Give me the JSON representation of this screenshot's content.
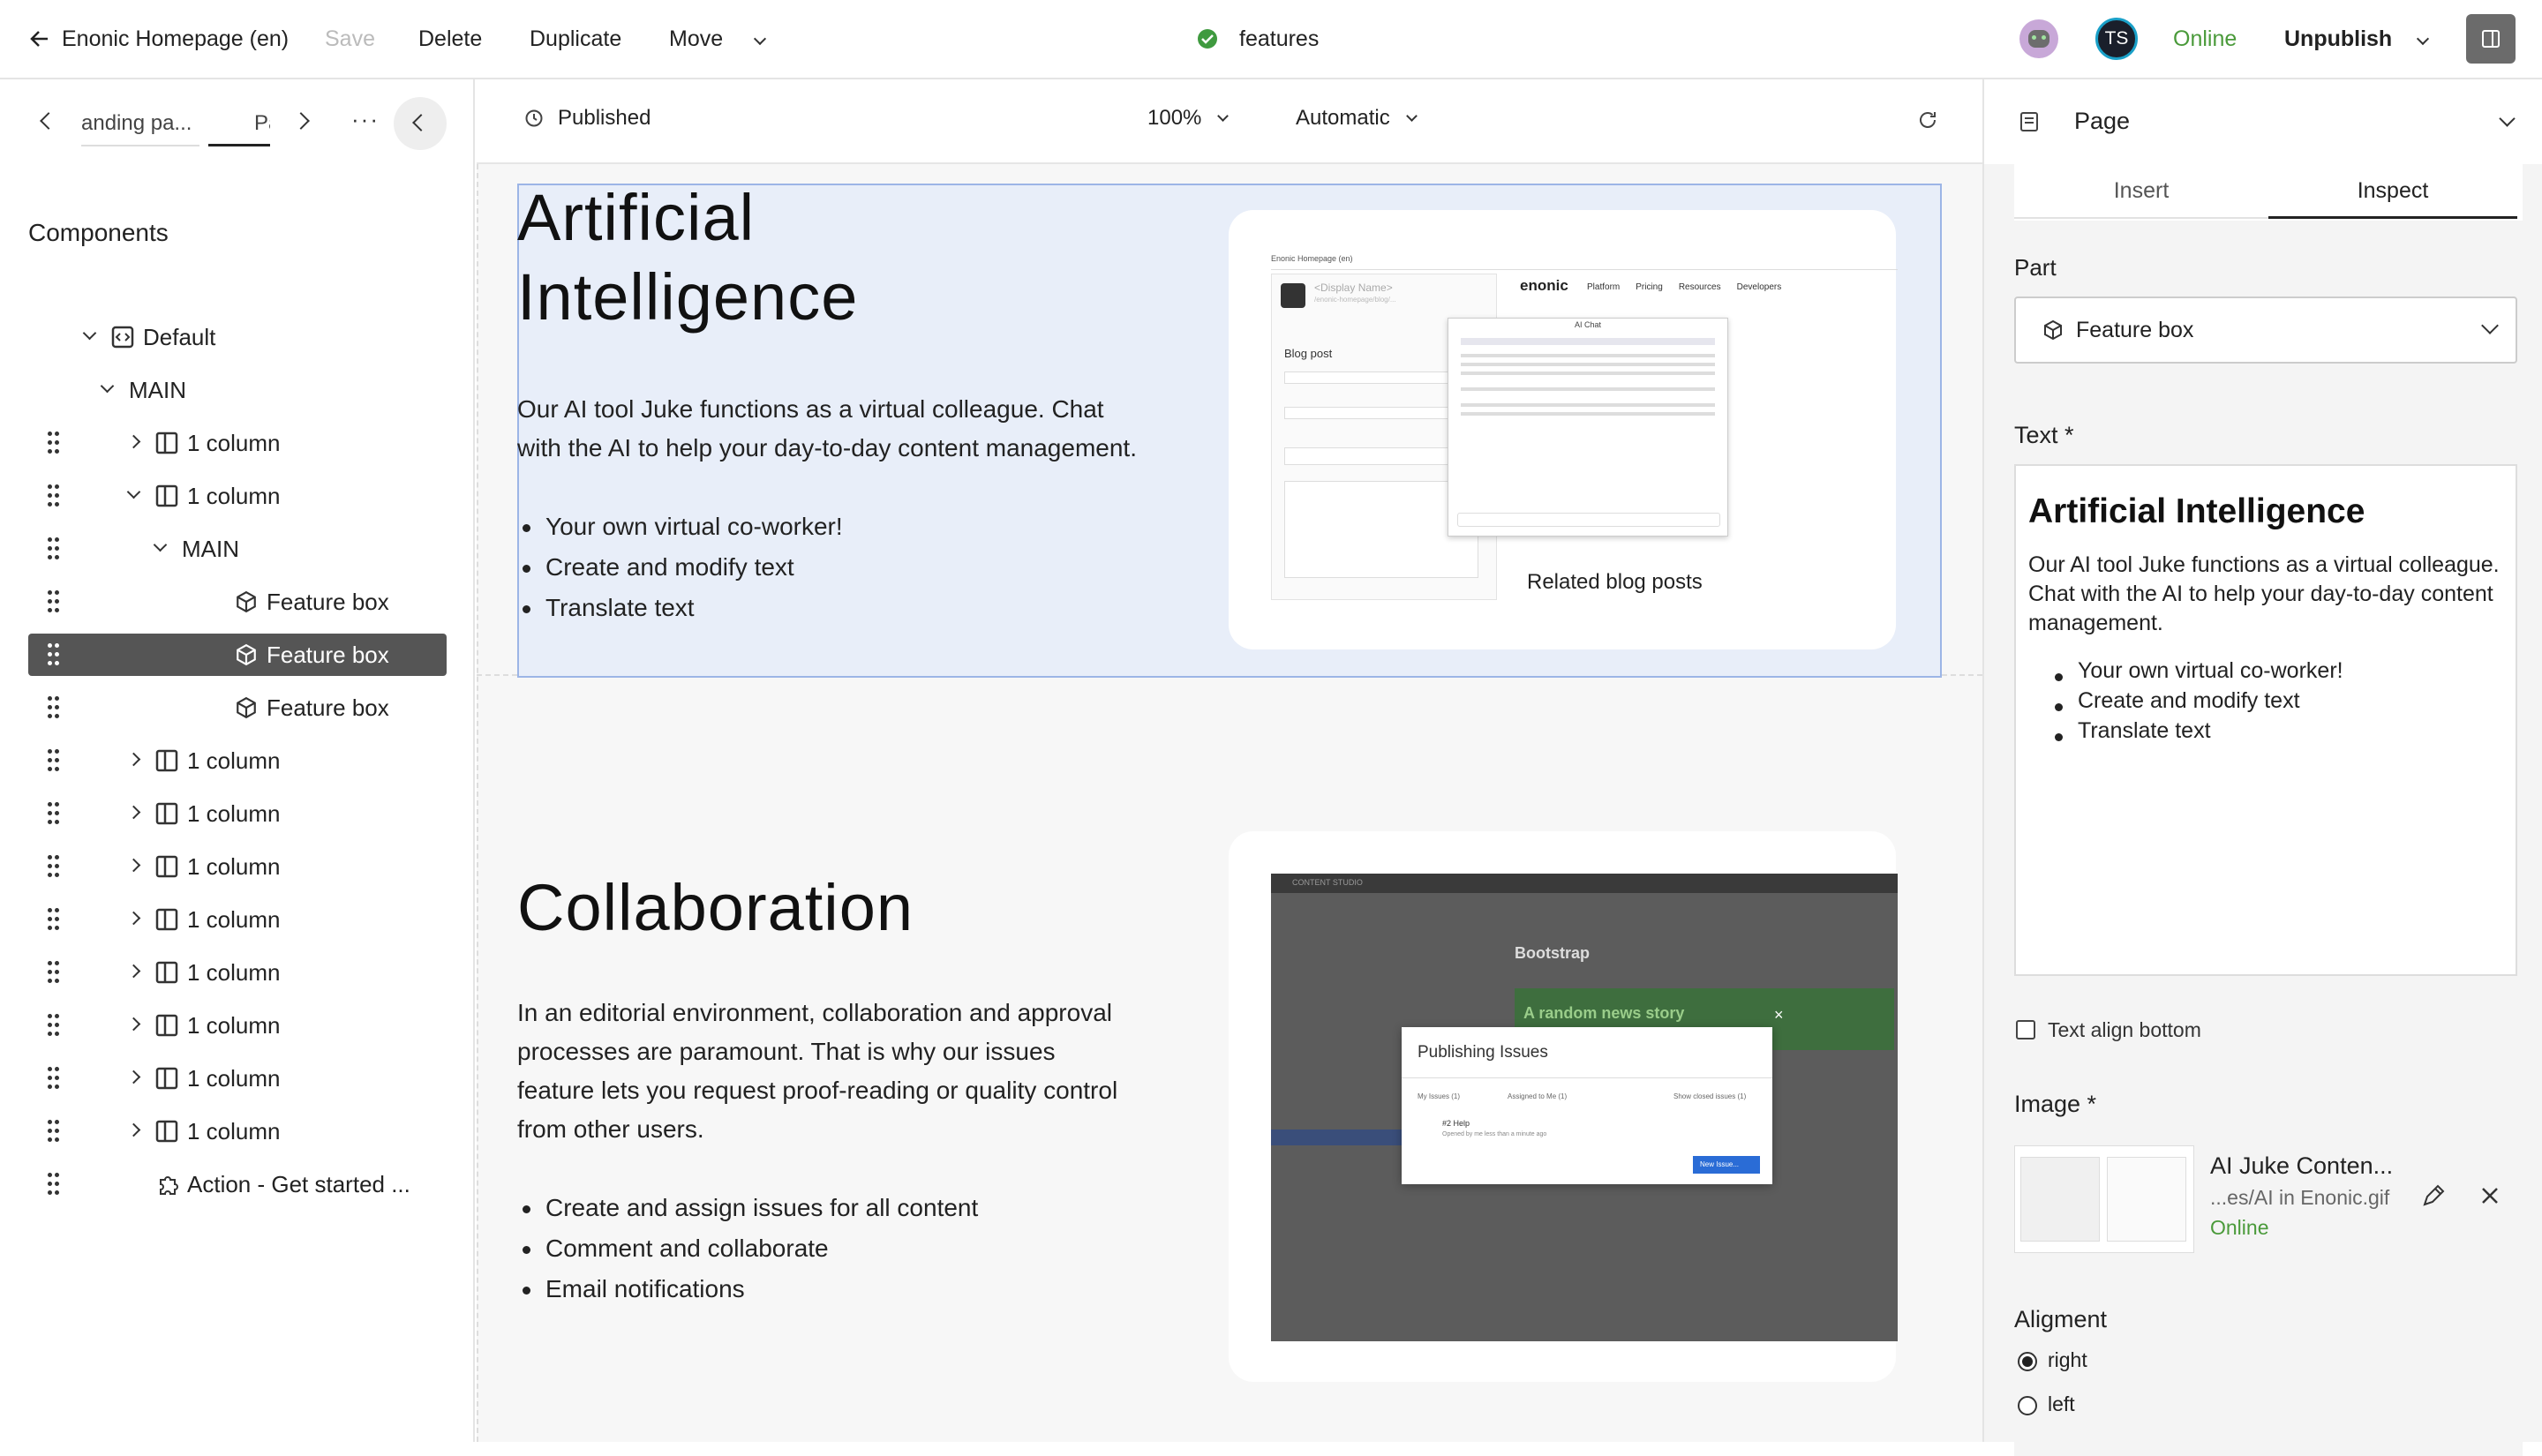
{
  "topbar": {
    "back_label": "Enonic Homepage (en)",
    "save_label": "Save",
    "delete_label": "Delete",
    "duplicate_label": "Duplicate",
    "move_label": "Move",
    "content_name": "features",
    "avatar_initials": "TS",
    "status": "Online",
    "unpublish_label": "Unpublish"
  },
  "left": {
    "tab1": "anding pa...",
    "tab2": "Pa",
    "components_title": "Components",
    "tree": [
      {
        "label": "Default",
        "icon": "template-icon",
        "indent": 0,
        "expanded": true
      },
      {
        "label": "MAIN",
        "icon": "",
        "indent": 1,
        "expanded": true
      },
      {
        "label": "1 column",
        "icon": "layout-icon",
        "indent": 2,
        "expanded": false
      },
      {
        "label": "1 column",
        "icon": "layout-icon",
        "indent": 2,
        "expanded": true
      },
      {
        "label": "MAIN",
        "icon": "",
        "indent": 3,
        "expanded": true
      },
      {
        "label": "Feature box",
        "icon": "part-icon",
        "indent": 4
      },
      {
        "label": "Feature box",
        "icon": "part-icon",
        "indent": 4,
        "selected": true
      },
      {
        "label": "Feature box",
        "icon": "part-icon",
        "indent": 4
      },
      {
        "label": "1 column",
        "icon": "layout-icon",
        "indent": 2,
        "expanded": false
      },
      {
        "label": "1 column",
        "icon": "layout-icon",
        "indent": 2,
        "expanded": false
      },
      {
        "label": "1 column",
        "icon": "layout-icon",
        "indent": 2,
        "expanded": false
      },
      {
        "label": "1 column",
        "icon": "layout-icon",
        "indent": 2,
        "expanded": false
      },
      {
        "label": "1 column",
        "icon": "layout-icon",
        "indent": 2,
        "expanded": false
      },
      {
        "label": "1 column",
        "icon": "layout-icon",
        "indent": 2,
        "expanded": false
      },
      {
        "label": "1 column",
        "icon": "layout-icon",
        "indent": 2,
        "expanded": false
      },
      {
        "label": "1 column",
        "icon": "layout-icon",
        "indent": 2,
        "expanded": false
      },
      {
        "label": "Action - Get started ...",
        "icon": "puzzle-icon",
        "indent": 2
      }
    ]
  },
  "center": {
    "status": "Published",
    "zoom": "100%",
    "mode": "Automatic",
    "sections": [
      {
        "title_line1": "Artificial",
        "title_line2": "Intelligence",
        "paragraph": "Our AI tool Juke functions as a virtual colleague. Chat with the AI to help your day-to-day content management.",
        "bullets": [
          "Your own virtual co-worker!",
          "Create and modify text",
          "Translate text"
        ],
        "image": {
          "app_title": "Enonic Homepage (en)",
          "display_name": "<Display Name>",
          "breadcrumb": "/enonic-homepage/blog/...",
          "form_title": "Blog post",
          "ai_chat": "AI Chat",
          "site_brand": "enonic",
          "nav": [
            "Platform",
            "Pricing",
            "Resources",
            "Developers"
          ],
          "related": "Related blog posts"
        }
      },
      {
        "title": "Collaboration",
        "paragraph": "In an editorial environment, collaboration and approval processes are paramount. That is why our issues feature lets you request proof-reading or quality control from other users.",
        "bullets": [
          "Create and assign issues for all content",
          "Comment and collaborate",
          "Email notifications"
        ],
        "image": {
          "app_title": "CONTENT STUDIO",
          "brand": "Bootstrap",
          "news": "A random news story",
          "dialog_title": "Publishing Issues",
          "filter1": "My Issues (1)",
          "filter2": "Assigned to Me (1)",
          "filter3": "Show closed issues (1)",
          "issue_title": "#2 Help",
          "issue_meta": "Opened by me less than a minute ago",
          "new_issue": "New Issue..."
        }
      }
    ]
  },
  "right": {
    "panel_title": "Page",
    "tab_insert": "Insert",
    "tab_inspect": "Inspect",
    "part_label": "Part",
    "part_value": "Feature box",
    "text_label": "Text *",
    "editor_heading": "Artificial Intelligence",
    "editor_paragraph": "Our AI tool Juke functions as a virtual colleague. Chat with the AI to help your day-to-day content management.",
    "editor_bullets": [
      "Your own virtual co-worker!",
      "Create and modify text",
      "Translate text"
    ],
    "text_align_bottom": "Text align bottom",
    "image_label": "Image *",
    "image_name": "AI Juke Conten...",
    "image_path": "...es/AI in Enonic.gif",
    "image_status": "Online",
    "alignment_label": "Aligment",
    "align_options": [
      "right",
      "left"
    ],
    "align_selected": "right"
  },
  "colors": {
    "online": "#4a9a3a",
    "selected_bg": "#555555",
    "highlight": "#e8eef9",
    "highlight_border": "#9cb5e6",
    "published_check": "#3f9a3f"
  }
}
